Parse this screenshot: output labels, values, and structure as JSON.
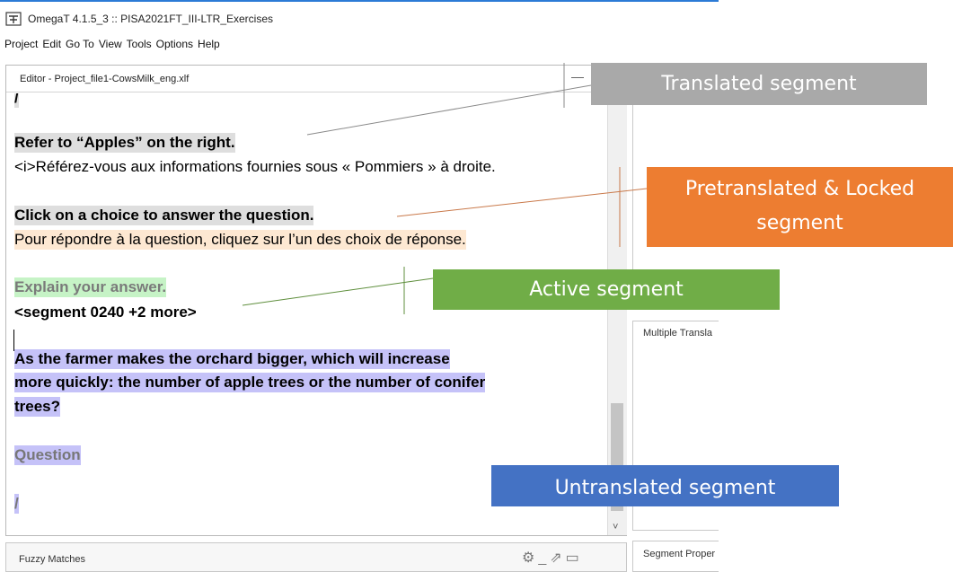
{
  "window": {
    "title": "OmegaT 4.1.5_3 :: PISA2021FT_III-LTR_Exercises",
    "icon": "omegat-app-icon"
  },
  "menu": [
    "Project",
    "Edit",
    "Go To",
    "View",
    "Tools",
    "Options",
    "Help"
  ],
  "editor": {
    "title": "Editor - Project_file1-CowsMilk_eng.xlf",
    "segments": [
      {
        "text": "/",
        "style": "gray-source"
      },
      {
        "text": "Refer to “Apples” on the right.",
        "style": "gray-source"
      },
      {
        "text": "<i>Référez-vous aux informations fournies sous « Pommiers » à droite.",
        "style": "target"
      },
      {
        "text": "Click on a choice to answer the question.",
        "style": "gray-source"
      },
      {
        "text": "Pour répondre à la question, cliquez sur l’un des choix de réponse.",
        "style": "locked-target"
      },
      {
        "text": "Explain your answer.",
        "style": "active-source"
      },
      {
        "text": "<segment 0240 +2 more>",
        "style": "active-target"
      },
      {
        "text": "As the farmer makes the orchard bigger, which will increase",
        "style": "untranslated"
      },
      {
        "text": "more quickly: the number of apple trees or the number of conifer",
        "style": "untranslated"
      },
      {
        "text": "trees?",
        "style": "untranslated"
      },
      {
        "text": "Question",
        "style": "untranslated-muted"
      },
      {
        "text": "/",
        "style": "untranslated-muted"
      }
    ]
  },
  "side_panels": {
    "multiple_translations": "Multiple Transla",
    "segment_properties": "Segment Proper"
  },
  "fuzzy_matches": {
    "label": "Fuzzy Matches"
  },
  "callouts": {
    "translated": "Translated segment",
    "pretranslated_line1": "Pretranslated & Locked",
    "pretranslated_line2": "segment",
    "active": "Active segment",
    "untranslated": "Untranslated segment"
  },
  "colors": {
    "translated": "#a9a9a9",
    "pretranslated": "#ed7d31",
    "active": "#70ad47",
    "untranslated": "#4472c4",
    "source_highlight": "#dedede",
    "locked_highlight": "#fde8d2",
    "active_highlight": "#c6f3c6",
    "untranslated_highlight": "#c5c2f8"
  }
}
